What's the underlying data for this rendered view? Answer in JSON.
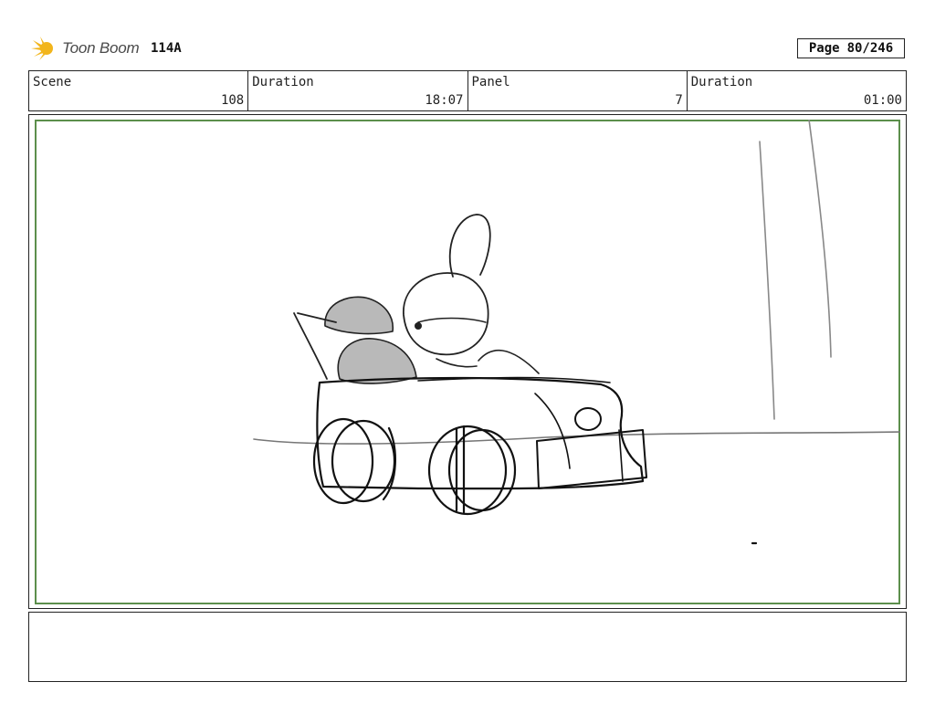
{
  "header": {
    "logo_text": "Toon Boom",
    "sheet_id": "114A",
    "page_label": "Page",
    "page_value": "80/246"
  },
  "info": {
    "scene_label": "Scene",
    "scene_value": "108",
    "duration_label": "Duration",
    "duration_value": "18:07",
    "panel_label": "Panel",
    "panel_value": "7",
    "panel_duration_label": "Duration",
    "panel_duration_value": "01:00"
  },
  "notes": {
    "text": ""
  },
  "colors": {
    "panel_border": "#5c8f4c",
    "logo_accent": "#f2b51c"
  }
}
